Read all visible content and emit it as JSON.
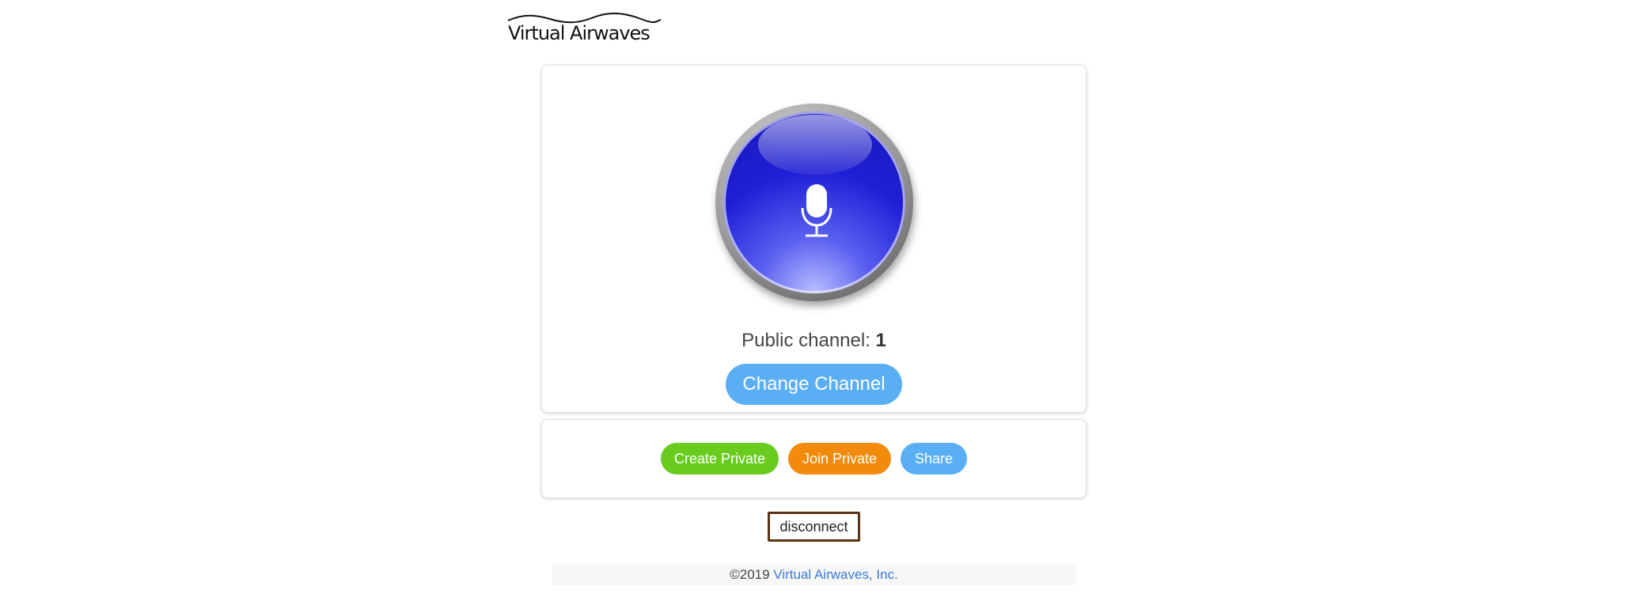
{
  "brand": {
    "logo_text": "Virtual Airwaves"
  },
  "ptt": {
    "icon": "microphone-icon",
    "color": "#1f1fd6"
  },
  "channel": {
    "label": "Public channel: ",
    "number": "1"
  },
  "buttons": {
    "change_channel": "Change Channel",
    "create_private": "Create Private",
    "join_private": "Join Private",
    "share": "Share",
    "disconnect": "disconnect"
  },
  "colors": {
    "blue_button": "#5aaef4",
    "green_button": "#6acb1f",
    "orange_button": "#f28b0c",
    "disconnect_border": "#5a3310",
    "link": "#3a7bd5"
  },
  "footer": {
    "copyright": "©2019 ",
    "company_link": "Virtual Airwaves, Inc."
  }
}
